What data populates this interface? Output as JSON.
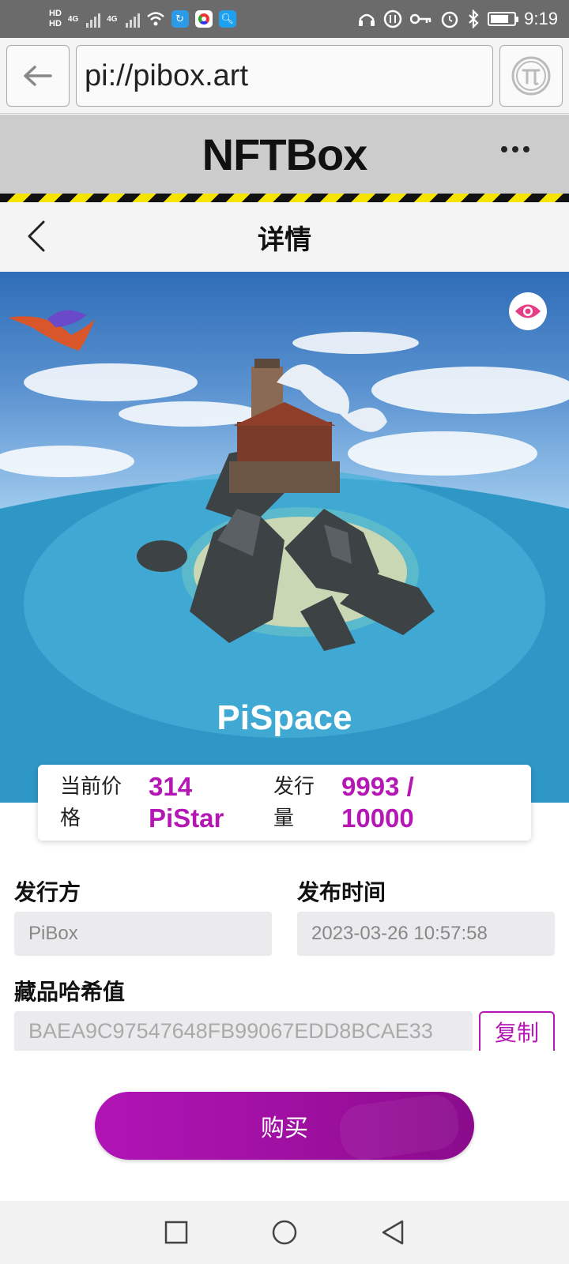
{
  "status_bar": {
    "hd1": "HD",
    "hd2": "HD",
    "net1": "4G",
    "net2": "4G",
    "time": "9:19"
  },
  "browser": {
    "url": "pi://pibox.art"
  },
  "app": {
    "title": "NFTBox"
  },
  "nav": {
    "title": "详情"
  },
  "nft": {
    "name": "PiSpace"
  },
  "info_card": {
    "price_label": "当前价格",
    "price_value": "314 PiStar",
    "supply_label": "发行量",
    "supply_value": "9993 / 10000"
  },
  "details": {
    "issuer_label": "发行方",
    "issuer_value": "PiBox",
    "release_label": "发布时间",
    "release_value": "2023-03-26 10:57:58",
    "hash_label": "藏品哈希值",
    "hash_value": "BAEA9C97547648FB99067EDD8BCAE33",
    "copy_label": "复制"
  },
  "actions": {
    "buy_label": "购买"
  },
  "colors": {
    "accent": "#b517b5",
    "header_bg": "#cccccc",
    "hazard_yellow": "#f5e400"
  }
}
